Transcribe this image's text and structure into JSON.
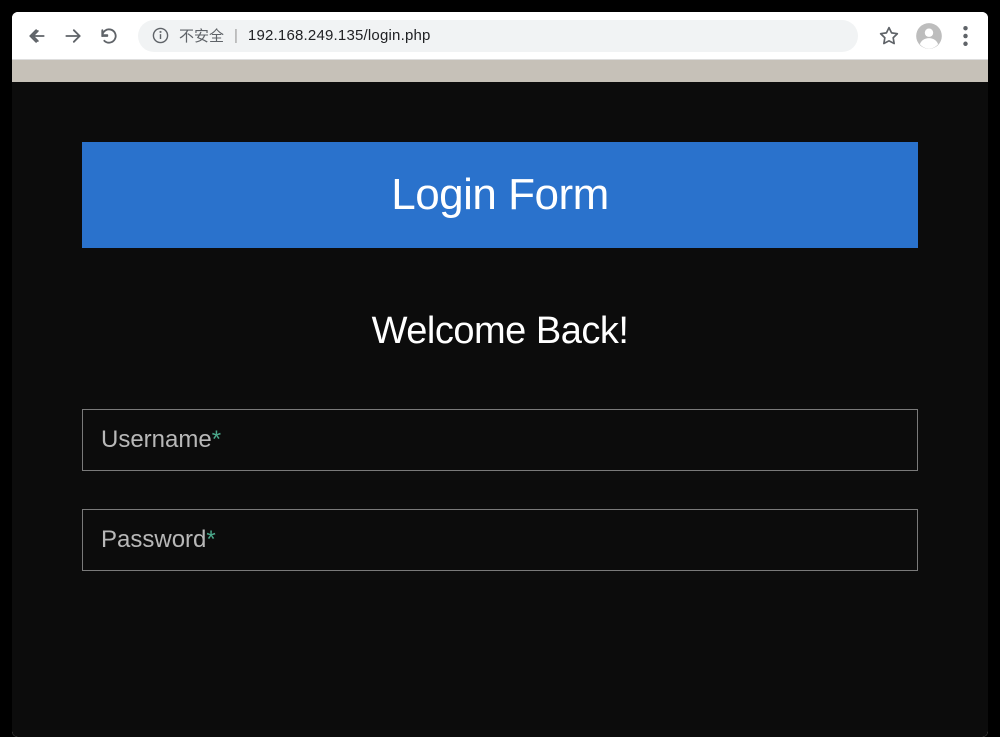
{
  "browser": {
    "insecure_label": "不安全",
    "url": "192.168.249.135/login.php"
  },
  "login": {
    "title": "Login Form",
    "welcome": "Welcome Back!",
    "username_label": "Username",
    "password_label": "Password",
    "required_mark": "*"
  }
}
